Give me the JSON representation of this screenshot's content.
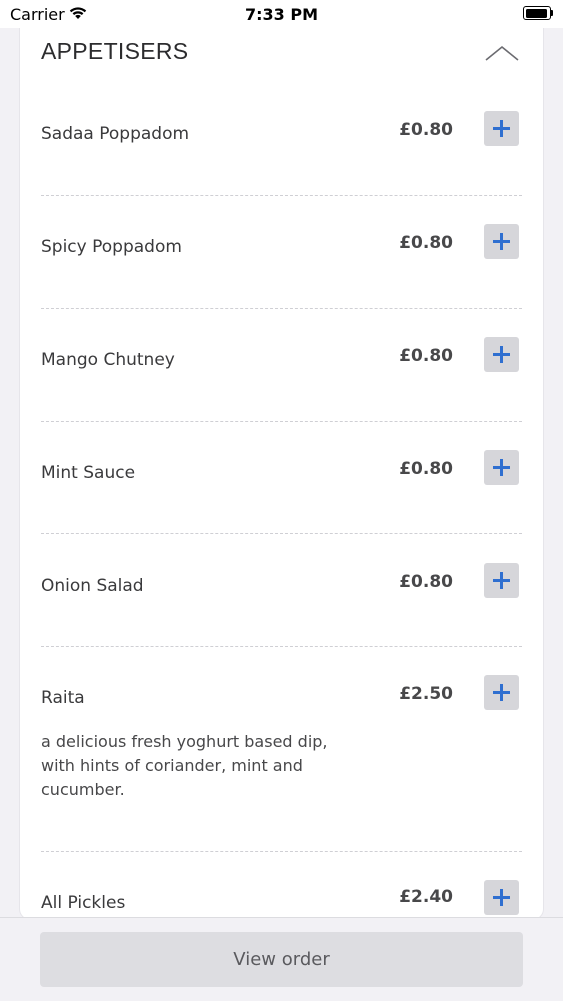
{
  "status_bar": {
    "carrier": "Carrier",
    "time": "7:33 PM"
  },
  "section": {
    "title": "APPETISERS",
    "collapse_icon": "chevron-up-icon"
  },
  "items": [
    {
      "name": "Sadaa Poppadom",
      "price": "£0.80"
    },
    {
      "name": "Spicy Poppadom",
      "price": "£0.80"
    },
    {
      "name": "Mango Chutney",
      "price": "£0.80"
    },
    {
      "name": "Mint Sauce",
      "price": "£0.80"
    },
    {
      "name": "Onion Salad",
      "price": "£0.80"
    },
    {
      "name": "Raita",
      "price": "£2.50",
      "description_lines": [
        "a delicious fresh yoghurt based dip,",
        "with hints of coriander, mint and",
        "cucumber."
      ]
    },
    {
      "name": "All Pickles",
      "price": "£2.40"
    }
  ],
  "footer": {
    "view_order_label": "View order"
  },
  "colors": {
    "accent": "#2f6fd0",
    "button_bg": "#d6d6da",
    "background": "#f2f1f5"
  }
}
